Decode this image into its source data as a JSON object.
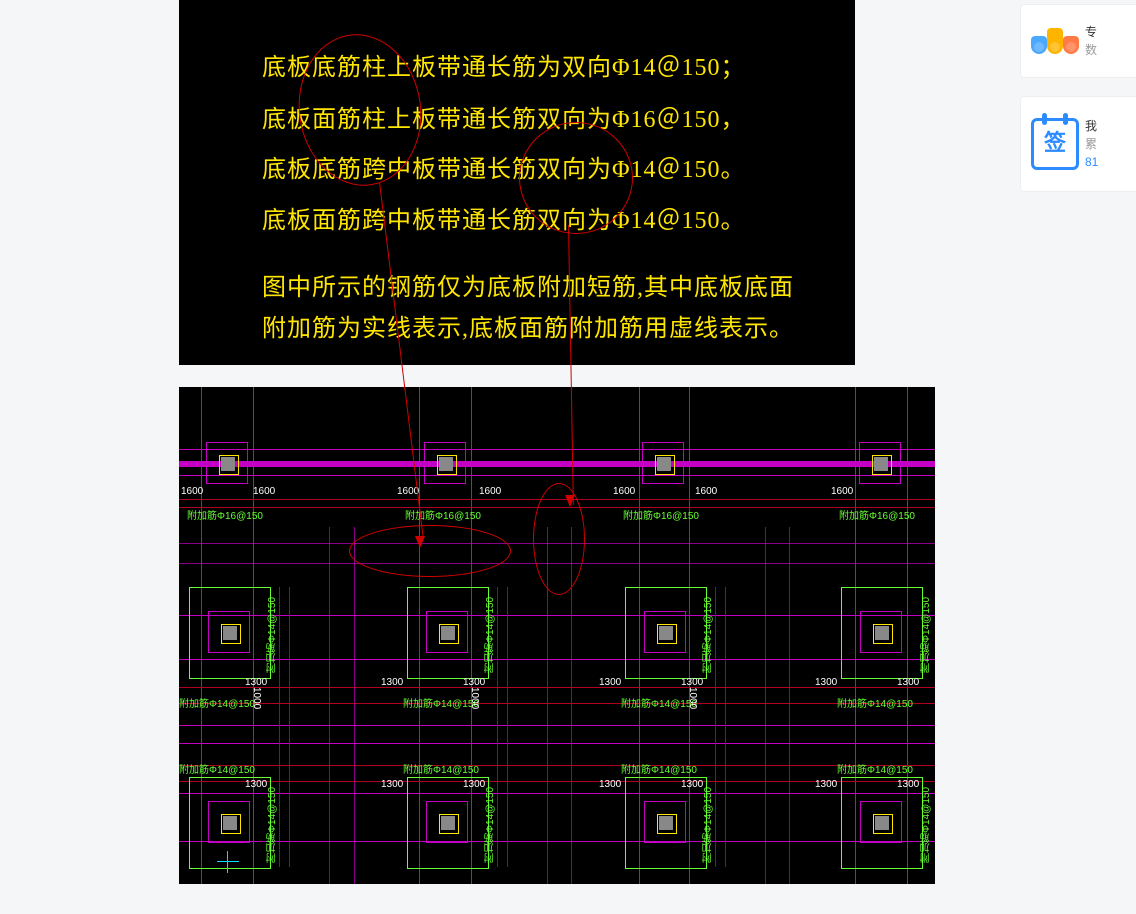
{
  "cad_top": {
    "lines": [
      "底板底筋柱上板带通长筋为双向Φ14＠150；",
      "底板面筋柱上板带通长筋双向为Φ16＠150，",
      "底板底筋跨中板带通长筋双向为Φ14＠150。",
      "底板面筋跨中板带通长筋双向为Φ14＠150。",
      "图中所示的钢筋仅为底板附加短筋,其中底板底面",
      "附加筋为实线表示,底板面筋附加筋用虚线表示。"
    ],
    "x": 83,
    "ys": [
      55,
      107,
      157,
      208,
      275,
      316
    ]
  },
  "cad_bottom": {
    "dim_1600_x": [
      15,
      232,
      450,
      660
    ],
    "dim_1600": "1600",
    "dim_1300_x": [
      34,
      208,
      426,
      640
    ],
    "dim_1300": "1300",
    "rebar_label_top": "附加筋Φ16@150",
    "rebar_label_mid": "附加筋Φ14@150",
    "dim_1000": "1000"
  },
  "sidebar": {
    "card1": {
      "title": "专",
      "sub": "数"
    },
    "card2": {
      "title": "我",
      "sub": "累",
      "link": "81",
      "zi": "签"
    }
  }
}
